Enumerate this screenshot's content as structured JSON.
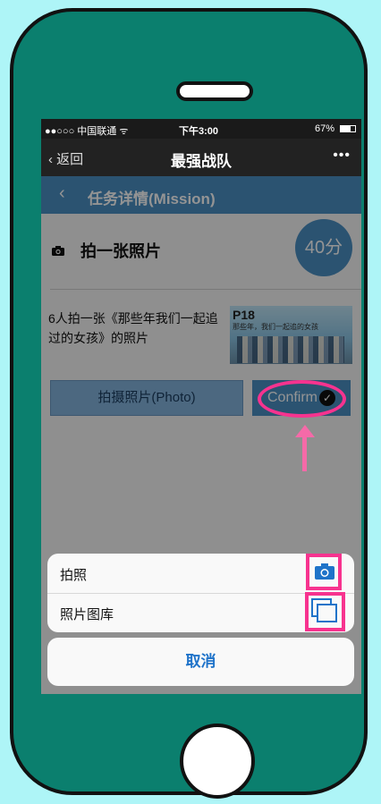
{
  "status_bar": {
    "carrier": "●●○○○ 中国联通 ᯤ",
    "time": "下午3:00",
    "battery": "67%"
  },
  "nav": {
    "back_label": "返回",
    "title": "最强战队",
    "more": "•••"
  },
  "mission_header": {
    "title": "任务详情(Mission)"
  },
  "task": {
    "title": "拍一张照片",
    "points": "40分",
    "description": "6人拍一张《那些年我们一起追过的女孩》的照片",
    "poster_label": "P18",
    "poster_subtitle": "那些年，我们一起追的女孩"
  },
  "buttons": {
    "photo": "拍摄照片(Photo)",
    "confirm": "Confirm",
    "confirm_check": "✓"
  },
  "action_sheet": {
    "items": [
      {
        "label": "拍照",
        "icon": "camera-icon"
      },
      {
        "label": "照片图库",
        "icon": "photo-library-icon"
      }
    ],
    "cancel": "取消"
  },
  "colors": {
    "accent": "#4a8fc3",
    "phone": "#0b7f6e",
    "highlight": "#f7338f"
  }
}
